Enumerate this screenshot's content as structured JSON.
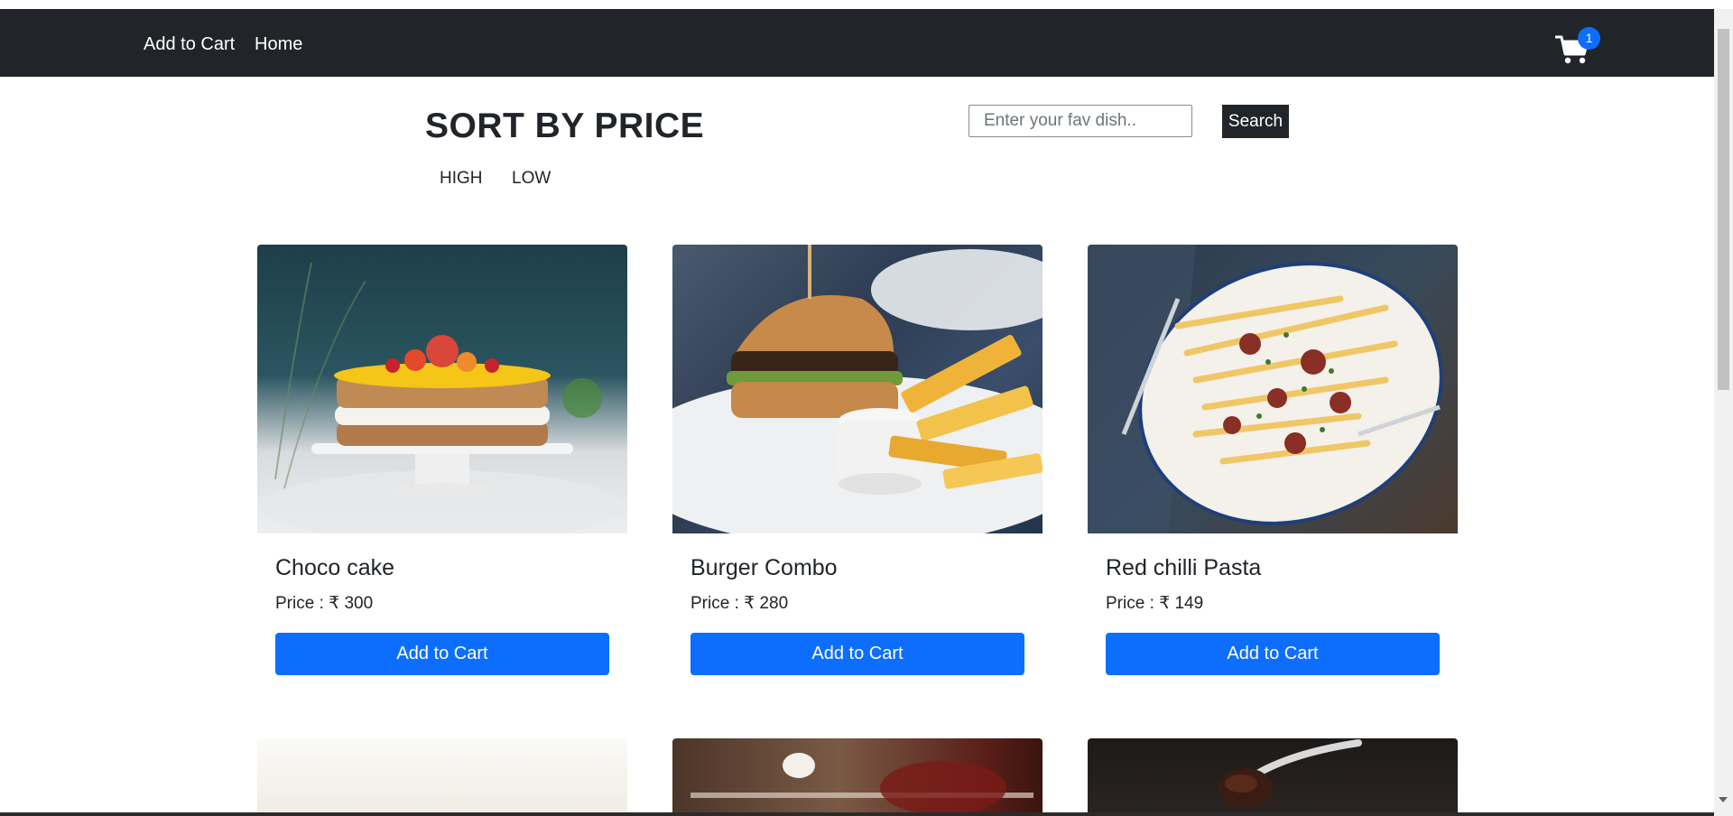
{
  "navbar": {
    "links": [
      "Add to Cart",
      "Home"
    ],
    "cart_count": "1",
    "cart_icon": "shopping-cart-icon"
  },
  "sort": {
    "title": "SORT BY PRICE",
    "options": [
      "HIGH",
      "LOW"
    ]
  },
  "search": {
    "placeholder": "Enter your fav dish..",
    "value": "",
    "button_label": "Search"
  },
  "products": [
    {
      "name": "Choco cake",
      "price_text": "Price : ₹ 300",
      "button_label": "Add to Cart",
      "image": "layered cake with fruit topping"
    },
    {
      "name": "Burger Combo",
      "price_text": "Price : ₹ 280",
      "button_label": "Add to Cart",
      "image": "burger with fries and dip"
    },
    {
      "name": "Red chilli Pasta",
      "price_text": "Price : ₹ 149",
      "button_label": "Add to Cart",
      "image": "pasta with meat on plate"
    }
  ],
  "colors": {
    "navbar_bg": "#212529",
    "primary": "#0d6efd",
    "search_button_bg": "#212529"
  }
}
